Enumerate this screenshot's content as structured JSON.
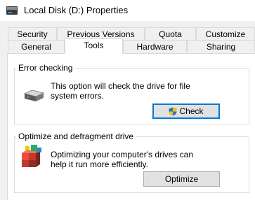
{
  "window": {
    "title": "Local Disk (D:) Properties",
    "icon": "drive-icon"
  },
  "tabs": {
    "back_row": [
      "Security",
      "Previous Versions",
      "Quota",
      "Customize"
    ],
    "front_row": [
      "General",
      "Tools",
      "Hardware",
      "Sharing"
    ],
    "active": "Tools"
  },
  "error_checking": {
    "legend": "Error checking",
    "description": "This option will check the drive for file system errors.",
    "button_label": "Check",
    "icon": "hard-drive-icon",
    "button_icon": "uac-shield-icon"
  },
  "optimize": {
    "legend": "Optimize and defragment drive",
    "description": "Optimizing your computer's drives can help it run more efficiently.",
    "button_label": "Optimize",
    "icon": "defragment-icon"
  }
}
